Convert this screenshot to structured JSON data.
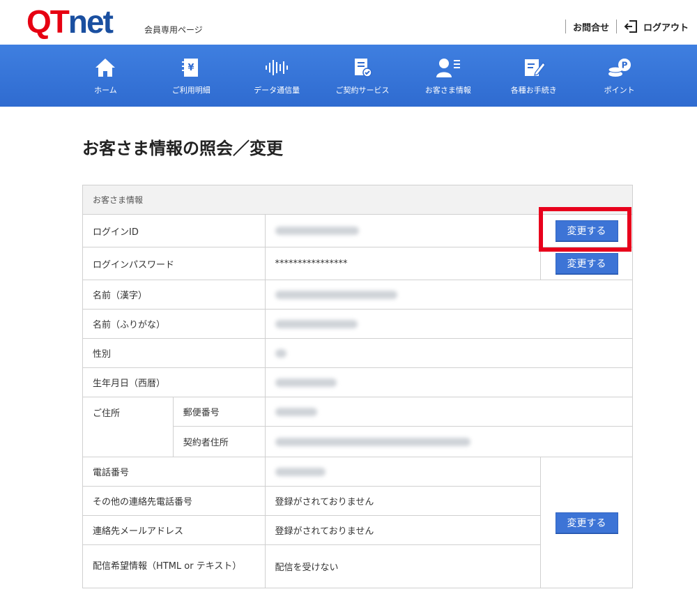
{
  "header": {
    "logo_q": "Q",
    "logo_t": "T",
    "logo_net": "net",
    "subtitle": "会員専用ページ",
    "contact": "お問合せ",
    "logout": "ログアウト"
  },
  "nav": [
    {
      "label": "ホーム",
      "icon": "home-icon"
    },
    {
      "label": "ご利用明細",
      "icon": "invoice-icon"
    },
    {
      "label": "データ通信量",
      "icon": "data-usage-icon"
    },
    {
      "label": "ご契約サービス",
      "icon": "contract-icon"
    },
    {
      "label": "お客さま情報",
      "icon": "user-info-icon"
    },
    {
      "label": "各種お手続き",
      "icon": "procedure-icon"
    },
    {
      "label": "ポイント",
      "icon": "point-icon"
    }
  ],
  "page_title": "お客さま情報の照会／変更",
  "table": {
    "section": "お客さま情報",
    "login_id_label": "ログインID",
    "password_label": "ログインパスワード",
    "password_value": "****************",
    "name_kanji_label": "名前（漢字）",
    "name_kana_label": "名前（ふりがな）",
    "gender_label": "性別",
    "birthday_label": "生年月日（西暦）",
    "address_label": "ご住所",
    "postal_label": "郵便番号",
    "contract_address_label": "契約者住所",
    "phone_label": "電話番号",
    "other_phone_label": "その他の連絡先電話番号",
    "other_phone_value": "登録がされておりません",
    "email_label": "連絡先メールアドレス",
    "email_value": "登録がされておりません",
    "delivery_label": "配信希望情報（HTML or テキスト）",
    "delivery_value": "配信を受けない",
    "change_button": "変更する"
  },
  "colors": {
    "brand_red": "#e60012",
    "brand_blue": "#1a4fa0",
    "nav_blue": "#3a78dc",
    "button_blue": "#3d74d6",
    "highlight_red": "#e8001c"
  }
}
